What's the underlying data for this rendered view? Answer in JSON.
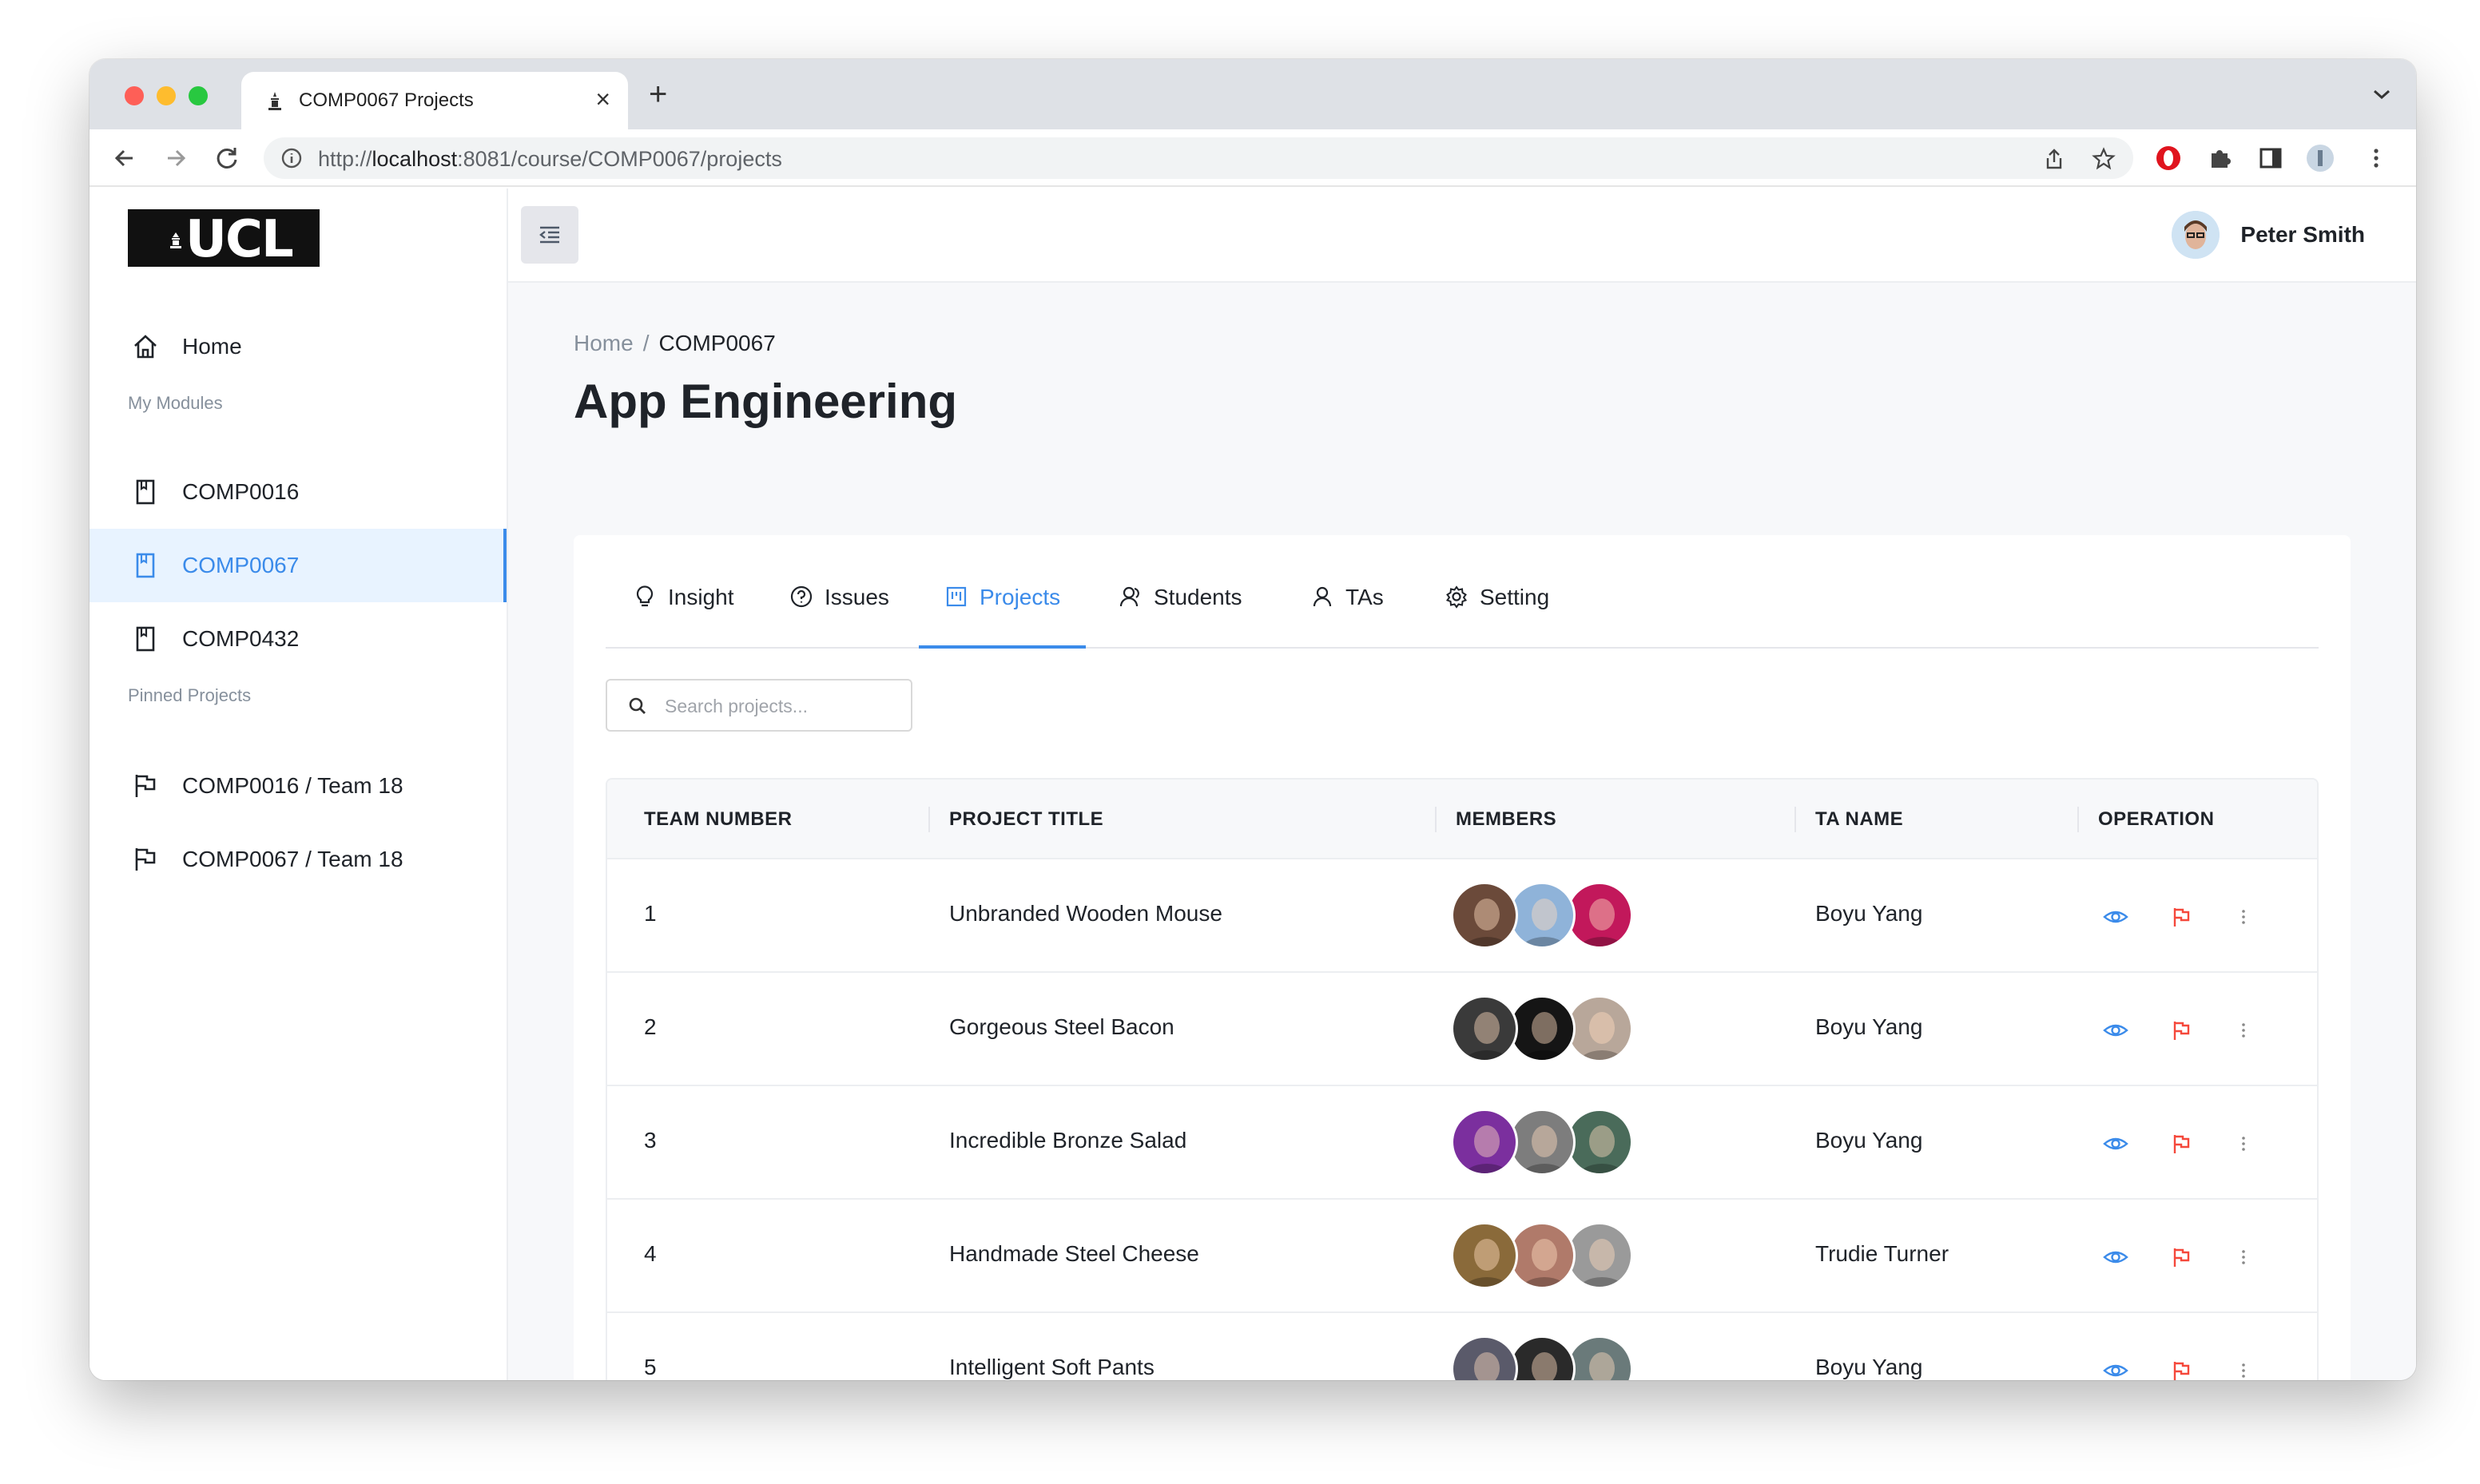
{
  "browser": {
    "tab_title": "COMP0067 Projects",
    "url_prefix": "http://",
    "url_host": "localhost",
    "url_rest": ":8081/course/COMP0067/projects"
  },
  "sidebar": {
    "logo": "UCL",
    "home_label": "Home",
    "modules_section": "My Modules",
    "modules": [
      {
        "label": "COMP0016",
        "active": false
      },
      {
        "label": "COMP0067",
        "active": true
      },
      {
        "label": "COMP0432",
        "active": false
      }
    ],
    "pinned_section": "Pinned Projects",
    "pinned": [
      {
        "label": "COMP0016 / Team 18"
      },
      {
        "label": "COMP0067 / Team 18"
      }
    ]
  },
  "header": {
    "user_name": "Peter Smith"
  },
  "breadcrumb": {
    "home": "Home",
    "separator": "/",
    "current": "COMP0067"
  },
  "page": {
    "title": "App Engineering"
  },
  "tabs": [
    {
      "label": "Insight",
      "icon": "bulb-icon"
    },
    {
      "label": "Issues",
      "icon": "question-circle-icon"
    },
    {
      "label": "Projects",
      "icon": "project-board-icon",
      "active": true
    },
    {
      "label": "Students",
      "icon": "students-icon"
    },
    {
      "label": "TAs",
      "icon": "user-icon"
    },
    {
      "label": "Setting",
      "icon": "gear-icon"
    }
  ],
  "search": {
    "placeholder": "Search projects...",
    "value": ""
  },
  "table": {
    "headers": [
      "TEAM NUMBER",
      "PROJECT TITLE",
      "MEMBERS",
      "TA NAME",
      "OPERATION"
    ],
    "rows": [
      {
        "team": "1",
        "title": "Unbranded Wooden Mouse",
        "ta": "Boyu Yang",
        "avatars": [
          "#6b4a3a",
          "#8fb3d9",
          "#c2185b"
        ]
      },
      {
        "team": "2",
        "title": "Gorgeous Steel Bacon",
        "ta": "Boyu Yang",
        "avatars": [
          "#3a3a3a",
          "#151515",
          "#b8a79a"
        ]
      },
      {
        "team": "3",
        "title": "Incredible Bronze Salad",
        "ta": "Boyu Yang",
        "avatars": [
          "#7b2f9e",
          "#7d7d7d",
          "#4a6b5a"
        ]
      },
      {
        "team": "4",
        "title": "Handmade Steel Cheese",
        "ta": "Trudie Turner",
        "avatars": [
          "#8a6a3a",
          "#b07a6a",
          "#9a9a9a"
        ]
      },
      {
        "team": "5",
        "title": "Intelligent Soft Pants",
        "ta": "Boyu Yang",
        "avatars": [
          "#5a5a6a",
          "#2a2a2a",
          "#6a7a7a"
        ]
      }
    ]
  },
  "colors": {
    "accent": "#3b8bea",
    "flag": "#f5483b",
    "active_bg": "#e8f3ff"
  }
}
